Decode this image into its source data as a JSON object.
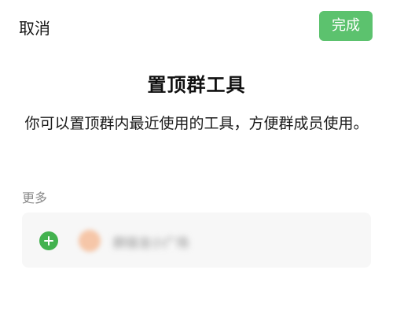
{
  "topbar": {
    "cancel_label": "取消",
    "done_label": "完成"
  },
  "main": {
    "title": "置顶群工具",
    "description": "你可以置顶群内最近使用的工具，方便群成员使用。"
  },
  "more_section": {
    "label": "更多",
    "items": [
      {
        "icon": "add-circle-icon",
        "app_icon": "app-icon",
        "name": "群接龙小广场"
      }
    ]
  },
  "colors": {
    "accent_green": "#5cc26e",
    "add_icon_green": "#43b24f",
    "card_background": "#f7f7f7",
    "secondary_text": "#8a8a8a"
  }
}
